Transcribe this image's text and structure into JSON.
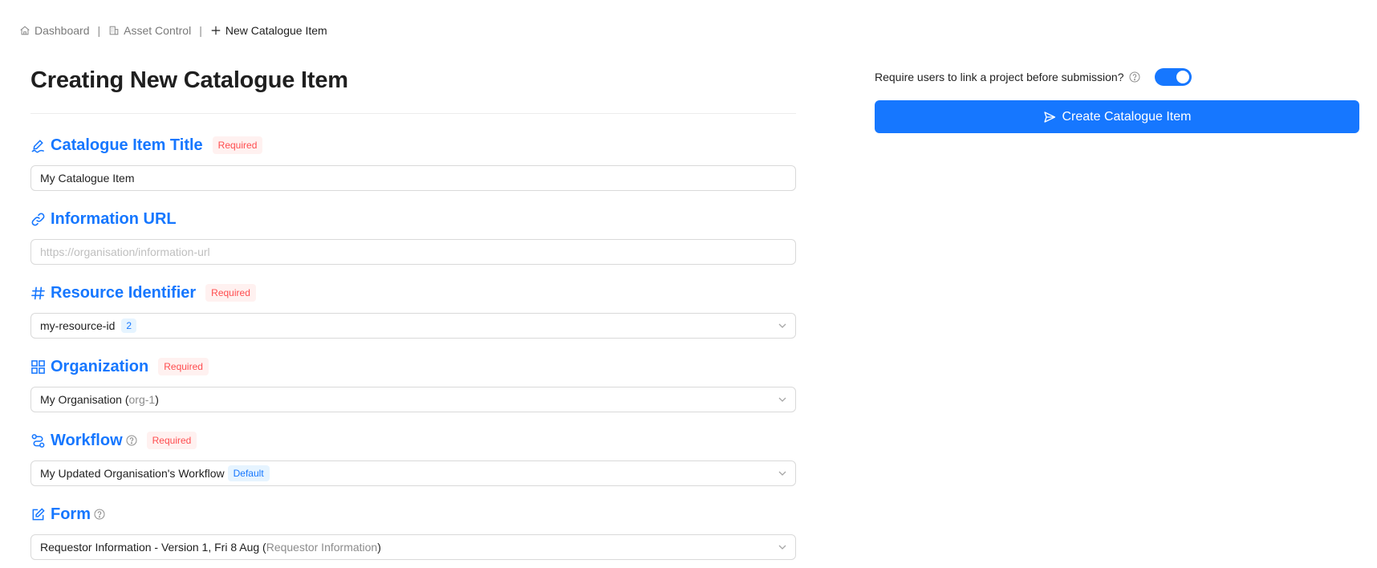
{
  "breadcrumb": {
    "items": [
      {
        "label": "Dashboard",
        "icon": "home-icon"
      },
      {
        "label": "Asset Control",
        "icon": "building-icon"
      },
      {
        "label": "New Catalogue Item",
        "icon": "plus-icon"
      }
    ],
    "separator": "|"
  },
  "page": {
    "title": "Creating New Catalogue Item"
  },
  "required_label": "Required",
  "fields": {
    "title": {
      "label": "Catalogue Item Title",
      "icon": "signature-icon",
      "value": "My Catalogue Item"
    },
    "url": {
      "label": "Information URL",
      "icon": "link-icon",
      "placeholder": "https://organisation/information-url"
    },
    "resource": {
      "label": "Resource Identifier",
      "icon": "hash-icon",
      "value": "my-resource-id",
      "count": "2"
    },
    "organization": {
      "label": "Organization",
      "icon": "grid-icon",
      "value": "My Organisation",
      "paren_open": " (",
      "code": "org-1",
      "paren_close": ")"
    },
    "workflow": {
      "label": "Workflow",
      "icon": "workflow-icon",
      "value": "My Updated Organisation's Workflow",
      "tag": "Default"
    },
    "form": {
      "label": "Form",
      "icon": "edit-icon",
      "value": "Requestor Information - Version 1, Fri 8 Aug",
      "paren_open": " (",
      "sub": "Requestor Information",
      "paren_close": ")"
    }
  },
  "sidebar": {
    "toggle_label": "Require users to link a project before submission?",
    "toggle_on": true,
    "submit_label": "Create Catalogue Item"
  },
  "colors": {
    "accent": "#1677ff",
    "required_bg": "#fff1f0",
    "required_text": "#ff4d4f"
  }
}
